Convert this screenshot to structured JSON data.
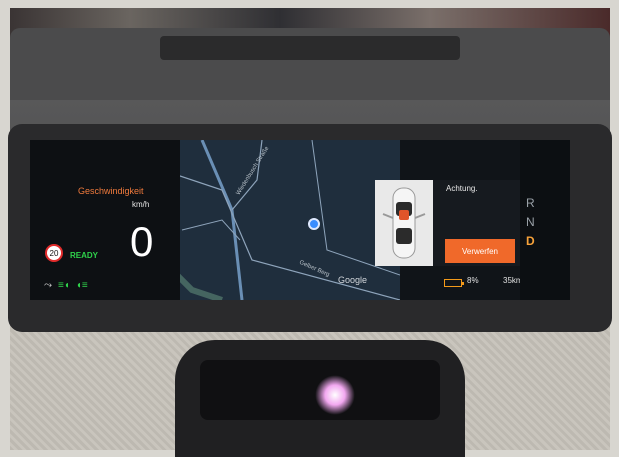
{
  "cluster": {
    "speed_title": "Geschwindigkeit",
    "speed_unit": "km/h",
    "speed_value": "0",
    "speed_limit": "20",
    "ready_status": "READY",
    "bottom_icons": [
      "wiper-icon",
      "fog-light-icon",
      "headlight-icon"
    ]
  },
  "map": {
    "provider": "Google",
    "street_labels": [
      "Wiedenbusch Straße",
      "Gelber Berg"
    ]
  },
  "alert": {
    "title": "Achtung.",
    "dismiss_label": "Verwerfen"
  },
  "gears": {
    "options": [
      "R",
      "N",
      "D"
    ],
    "selected": "D"
  },
  "status": {
    "battery_percent": "8%",
    "range": "35km"
  },
  "colors": {
    "accent_orange": "#f0692a",
    "ready_green": "#2fd24b",
    "warning_red": "#e02b2b",
    "map_bg": "#1f2e3d"
  }
}
